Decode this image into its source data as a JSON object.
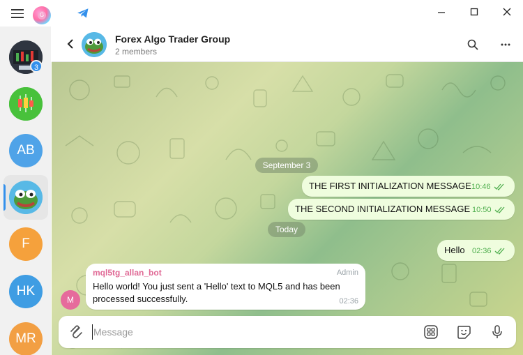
{
  "window": {
    "menu_icon": "hamburger-icon",
    "app_logo_letter": "G",
    "colors": {
      "accent": "#3390ec",
      "outgoing_bubble": "#effdde",
      "incoming_bubble": "#ffffff",
      "sender": "#e06a96",
      "read_ticks": "#4fae4e"
    }
  },
  "sidebar": {
    "unread_badge": "3",
    "chats": [
      {
        "name": "chart-avatar-1",
        "initials": ""
      },
      {
        "name": "candles-avatar",
        "initials": ""
      },
      {
        "name": "ab-avatar",
        "initials": "AB",
        "color": "#4fa3e8"
      },
      {
        "name": "frog-avatar",
        "initials": "",
        "selected": true
      },
      {
        "name": "f-avatar",
        "initials": "F",
        "color": "#f5a13c"
      },
      {
        "name": "hk-avatar",
        "initials": "HK",
        "color": "#3f9de3"
      },
      {
        "name": "mr-avatar",
        "initials": "MR",
        "color": "#f29f43"
      }
    ]
  },
  "header": {
    "title": "Forex Algo Trader Group",
    "subtitle": "2 members"
  },
  "messages": {
    "date1": "September 3",
    "out1": {
      "text": "THE FIRST INITIALIZATION MESSAGE",
      "time": "10:46"
    },
    "out2": {
      "text": "THE SECOND INITIALIZATION MESSAGE",
      "time": "10:50"
    },
    "date2": "Today",
    "out3": {
      "text": "Hello",
      "time": "02:36"
    },
    "in1": {
      "sender": "mql5tg_allan_bot",
      "role": "Admin",
      "text": "Hello world! You just sent a 'Hello' text to MQL5 and has been processed successfully.",
      "time": "02:36",
      "avatar_letter": "M"
    }
  },
  "composer": {
    "placeholder": "Message"
  }
}
